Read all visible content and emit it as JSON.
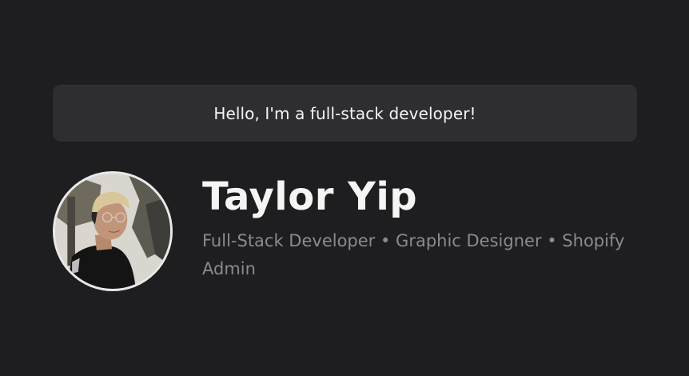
{
  "greeting": {
    "text": "Hello, I'm a full-stack developer!"
  },
  "profile": {
    "name": "Taylor Yip",
    "roles": "Full-Stack Developer • Graphic Designer • Shopify Admin",
    "avatar_icon": "profile-photo"
  },
  "colors": {
    "background": "#1e1e20",
    "banner": "#2e2e30",
    "name_text": "#f5f5f5",
    "roles_text": "#8b8b8e",
    "avatar_border": "#e9e9e9"
  }
}
